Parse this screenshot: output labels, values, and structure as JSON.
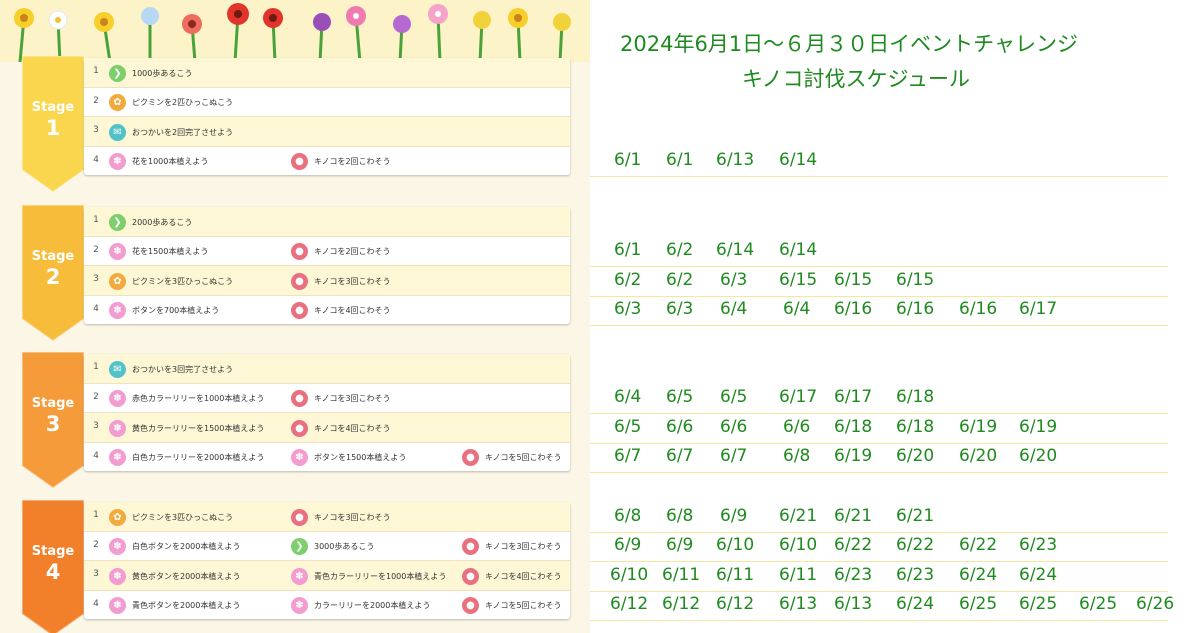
{
  "title_line1": "2024年6月1日～６月３０日イベントチャレンジ",
  "title_line2": "キノコ討伐スケジュール",
  "colors": {
    "stage1": "#f9d64e",
    "stage2": "#f7bd3a",
    "stage3": "#f59b3a",
    "stage4": "#f2802a",
    "text_green": "#1f8a1f",
    "row_alt": "#fef7d6"
  },
  "stages": [
    {
      "label": "Stage",
      "number": "1",
      "rows": [
        {
          "num": "1",
          "tasks": [
            {
              "icon": "walk-icon",
              "text": "1000歩あるこう"
            }
          ]
        },
        {
          "num": "2",
          "tasks": [
            {
              "icon": "pikmin-icon",
              "text": "ピクミンを2匹ひっこぬこう"
            }
          ]
        },
        {
          "num": "3",
          "tasks": [
            {
              "icon": "errand-icon",
              "text": "おつかいを2回完了させよう"
            }
          ]
        },
        {
          "num": "4",
          "tasks": [
            {
              "icon": "flower-icon",
              "text": "花を1000本植えよう"
            },
            {
              "icon": "mushroom-icon",
              "text": "キノコを2回こわそう"
            }
          ]
        }
      ]
    },
    {
      "label": "Stage",
      "number": "2",
      "rows": [
        {
          "num": "1",
          "tasks": [
            {
              "icon": "walk-icon",
              "text": "2000歩あるこう"
            }
          ]
        },
        {
          "num": "2",
          "tasks": [
            {
              "icon": "flower-icon",
              "text": "花を1500本植えよう"
            },
            {
              "icon": "mushroom-icon",
              "text": "キノコを2回こわそう"
            }
          ]
        },
        {
          "num": "3",
          "tasks": [
            {
              "icon": "pikmin-icon",
              "text": "ピクミンを3匹ひっこぬこう"
            },
            {
              "icon": "mushroom-icon",
              "text": "キノコを3回こわそう"
            }
          ]
        },
        {
          "num": "4",
          "tasks": [
            {
              "icon": "flower-icon",
              "text": "ボタンを700本植えよう"
            },
            {
              "icon": "mushroom-icon",
              "text": "キノコを4回こわそう"
            }
          ]
        }
      ]
    },
    {
      "label": "Stage",
      "number": "3",
      "rows": [
        {
          "num": "1",
          "tasks": [
            {
              "icon": "errand-icon",
              "text": "おつかいを3回完了させよう"
            }
          ]
        },
        {
          "num": "2",
          "tasks": [
            {
              "icon": "flower-icon",
              "text": "赤色カラーリリーを1000本植えよう"
            },
            {
              "icon": "mushroom-icon",
              "text": "キノコを3回こわそう"
            }
          ]
        },
        {
          "num": "3",
          "tasks": [
            {
              "icon": "flower-icon",
              "text": "黄色カラーリリーを1500本植えよう"
            },
            {
              "icon": "mushroom-icon",
              "text": "キノコを4回こわそう"
            }
          ]
        },
        {
          "num": "4",
          "tasks": [
            {
              "icon": "flower-icon",
              "text": "白色カラーリリーを2000本植えよう"
            },
            {
              "icon": "flower-icon",
              "text": "ボタンを1500本植えよう"
            },
            {
              "icon": "mushroom-icon",
              "text": "キノコを5回こわそう"
            }
          ]
        }
      ]
    },
    {
      "label": "Stage",
      "number": "4",
      "rows": [
        {
          "num": "1",
          "tasks": [
            {
              "icon": "pikmin-icon",
              "text": "ピクミンを3匹ひっこぬこう"
            },
            {
              "icon": "mushroom-icon",
              "text": "キノコを3回こわそう"
            }
          ]
        },
        {
          "num": "2",
          "tasks": [
            {
              "icon": "flower-icon",
              "text": "白色ボタンを2000本植えよう"
            },
            {
              "icon": "walk-icon",
              "text": "3000歩あるこう"
            },
            {
              "icon": "mushroom-icon",
              "text": "キノコを3回こわそう"
            }
          ]
        },
        {
          "num": "3",
          "tasks": [
            {
              "icon": "flower-icon",
              "text": "黄色ボタンを2000本植えよう"
            },
            {
              "icon": "flower-icon",
              "text": "青色カラーリリーを1000本植えよう"
            },
            {
              "icon": "mushroom-icon",
              "text": "キノコを4回こわそう"
            }
          ]
        },
        {
          "num": "4",
          "tasks": [
            {
              "icon": "flower-icon",
              "text": "青色ボタンを2000本植えよう"
            },
            {
              "icon": "flower-icon",
              "text": "カラーリリーを2000本植えよう"
            },
            {
              "icon": "mushroom-icon",
              "text": "キノコを5回こわそう"
            }
          ]
        }
      ]
    }
  ],
  "schedule": [
    {
      "stage": "1",
      "row": "4",
      "dates": [
        "6/1",
        "6/1",
        "6/13",
        "6/14"
      ]
    },
    {
      "stage": "2",
      "row": "2",
      "dates": [
        "6/1",
        "6/2",
        "6/14",
        "6/14"
      ]
    },
    {
      "stage": "2",
      "row": "3",
      "dates": [
        "6/2",
        "6/2",
        "6/3",
        "6/15",
        "6/15",
        "6/15"
      ]
    },
    {
      "stage": "2",
      "row": "4",
      "dates": [
        "6/3",
        "6/3",
        "6/4",
        "6/4",
        "6/16",
        "6/16",
        "6/16",
        "6/17"
      ]
    },
    {
      "stage": "3",
      "row": "2",
      "dates": [
        "6/4",
        "6/5",
        "6/5",
        "6/17",
        "6/17",
        "6/18"
      ]
    },
    {
      "stage": "3",
      "row": "3",
      "dates": [
        "6/5",
        "6/6",
        "6/6",
        "6/6",
        "6/18",
        "6/18",
        "6/19",
        "6/19"
      ]
    },
    {
      "stage": "3",
      "row": "4",
      "dates": [
        "6/7",
        "6/7",
        "6/7",
        "6/8",
        "6/19",
        "6/20",
        "6/20",
        "6/20"
      ]
    },
    {
      "stage": "4",
      "row": "1",
      "dates": [
        "6/8",
        "6/8",
        "6/9",
        "6/21",
        "6/21",
        "6/21"
      ]
    },
    {
      "stage": "4",
      "row": "2",
      "dates": [
        "6/9",
        "6/9",
        "6/10",
        "6/10",
        "6/22",
        "6/22",
        "6/22",
        "6/23"
      ]
    },
    {
      "stage": "4",
      "row": "3",
      "dates": [
        "6/10",
        "6/11",
        "6/11",
        "6/11",
        "6/23",
        "6/23",
        "6/24",
        "6/24"
      ]
    },
    {
      "stage": "4",
      "row": "4",
      "dates": [
        "6/12",
        "6/12",
        "6/12",
        "6/13",
        "6/13",
        "6/24",
        "6/25",
        "6/25",
        "6/25",
        "6/26"
      ]
    }
  ]
}
